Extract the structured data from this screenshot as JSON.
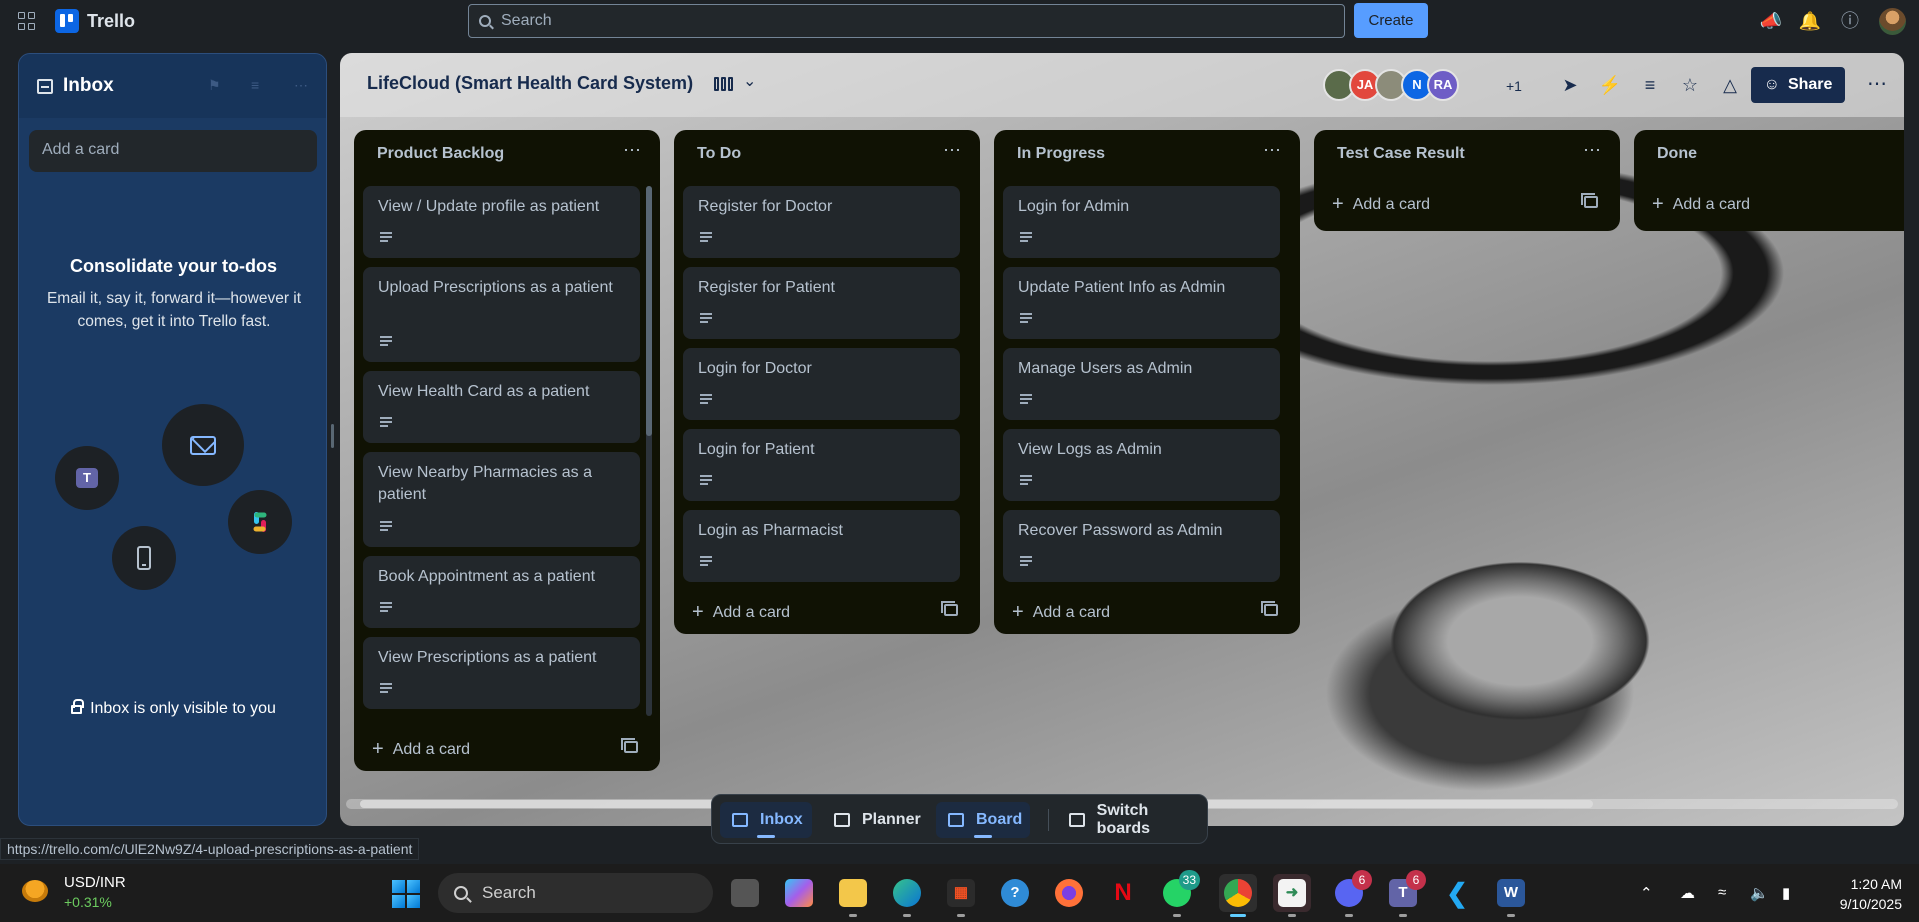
{
  "topbar": {
    "app_name": "Trello",
    "search_placeholder": "Search",
    "create_label": "Create"
  },
  "inbox": {
    "title": "Inbox",
    "add_card_placeholder": "Add a card",
    "promo_title": "Consolidate your to-dos",
    "promo_text": "Email it, say it, forward it—however it comes, get it into Trello fast.",
    "privacy_note": "Inbox is only visible to you"
  },
  "board": {
    "title": "LifeCloud (Smart Health Card System)",
    "members": [
      {
        "initials": "",
        "color": "#5a6b4a"
      },
      {
        "initials": "JA",
        "color": "#e2483d"
      },
      {
        "initials": "",
        "color": "#8c8c7a"
      },
      {
        "initials": "N",
        "color": "#0c66e4"
      },
      {
        "initials": "RA",
        "color": "#6e5dc6"
      }
    ],
    "members_overflow": "+1",
    "share_label": "Share",
    "lists": [
      {
        "title": "Product Backlog",
        "cards": [
          "View / Update profile as patient",
          "Upload Prescriptions as a patient",
          "View Health Card as a patient",
          "View Nearby Pharmacies as a patient",
          "Book Appointment as a patient",
          "View Prescriptions as a patient"
        ],
        "add_label": "Add a card"
      },
      {
        "title": "To Do",
        "cards": [
          "Register for Doctor",
          "Register for Patient",
          "Login for Doctor",
          "Login for Patient",
          "Login as Pharmacist"
        ],
        "add_label": "Add a card"
      },
      {
        "title": "In Progress",
        "cards": [
          "Login for Admin",
          "Update Patient Info as Admin",
          "Manage Users as Admin",
          "View Logs as Admin",
          "Recover Password as Admin"
        ],
        "add_label": "Add a card"
      },
      {
        "title": "Test Case Result",
        "cards": [],
        "add_label": "Add a card"
      },
      {
        "title": "Done",
        "cards": [],
        "add_label": "Add a card"
      }
    ]
  },
  "switcher": {
    "items": [
      "Inbox",
      "Planner",
      "Board",
      "Switch boards"
    ]
  },
  "status_url": "https://trello.com/c/UlE2Nw9Z/4-upload-prescriptions-as-a-patient",
  "taskbar": {
    "ticker_pair": "USD/INR",
    "ticker_change": "+0.31%",
    "search_label": "Search",
    "badges": {
      "whatsapp": "33",
      "discord": "6",
      "teams": "6"
    },
    "time": "1:20 AM",
    "date": "9/10/2025"
  },
  "colors": {
    "accent": "#579dff",
    "list_bg": "#101204",
    "card_bg": "#22272b",
    "inbox_bg": "#1b3a63"
  }
}
